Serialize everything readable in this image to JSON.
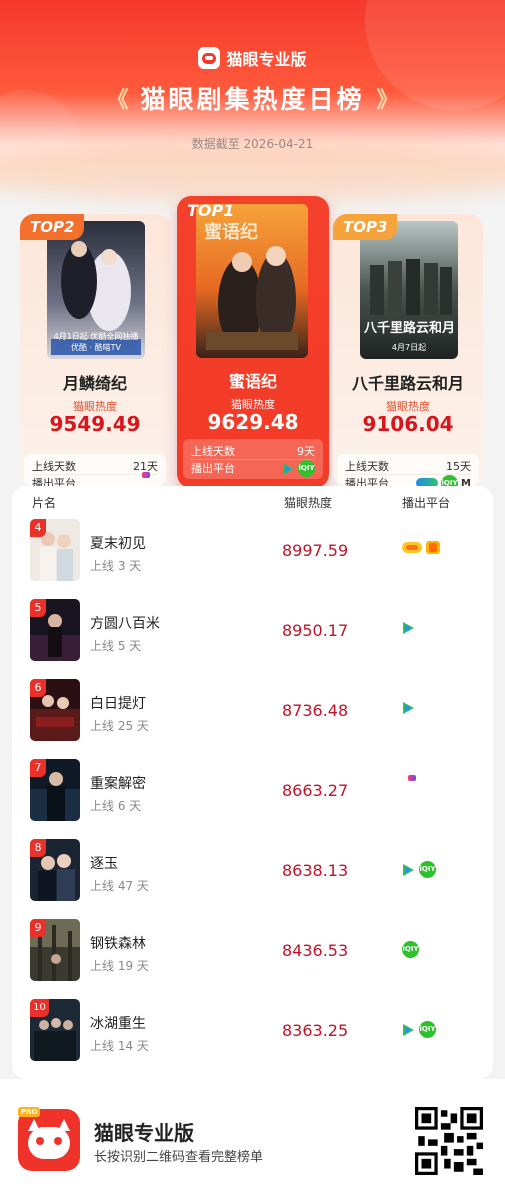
{
  "header": {
    "brand": "猫眼专业版",
    "title": "猫眼剧集热度日榜",
    "date_line": "数据截至 2026-04-21"
  },
  "top3": [
    {
      "rank_label": "TOP2",
      "name": "月鳞绮纪",
      "heat_label": "猫眼热度",
      "heat": "9549.49",
      "days_label": "上线天数",
      "days": "21天",
      "platform_label": "播出平台",
      "platforms": [
        "youku-icon"
      ],
      "poster_caption": "4月1日起 优酷全网独播",
      "poster_caption2": "优酷 · 酷喵TV"
    },
    {
      "rank_label": "TOP1",
      "name": "蜜语纪",
      "heat_label": "猫眼热度",
      "heat": "9629.48",
      "days_label": "上线天数",
      "days": "9天",
      "platform_label": "播出平台",
      "platforms": [
        "tencent-video-icon",
        "iqiyi-icon"
      ],
      "poster_art": "蜜语纪"
    },
    {
      "rank_label": "TOP3",
      "name": "八千里路云和月",
      "heat_label": "猫眼热度",
      "heat": "9106.04",
      "days_label": "上线天数",
      "days": "15天",
      "platform_label": "播出平台",
      "platforms": [
        "tencent-video-icon",
        "iqiyi-icon",
        "migu-icon"
      ],
      "poster_caption": "4月7日起",
      "poster_art": "八千里路云和月"
    }
  ],
  "list": {
    "headers": {
      "name": "片名",
      "heat": "猫眼热度",
      "platform": "播出平台"
    },
    "rows": [
      {
        "rank": "4",
        "name": "夏末初见",
        "days": "上线 3 天",
        "heat": "8997.59",
        "platforms": [
          "hunan-tv-icon",
          "mango-tv-icon"
        ]
      },
      {
        "rank": "5",
        "name": "方圆八百米",
        "days": "上线 5 天",
        "heat": "8950.17",
        "platforms": [
          "tencent-video-icon"
        ]
      },
      {
        "rank": "6",
        "name": "白日提灯",
        "days": "上线 25 天",
        "heat": "8736.48",
        "platforms": [
          "tencent-video-icon"
        ]
      },
      {
        "rank": "7",
        "name": "重案解密",
        "days": "上线 6 天",
        "heat": "8663.27",
        "platforms": [
          "youku-icon"
        ]
      },
      {
        "rank": "8",
        "name": "逐玉",
        "days": "上线 47 天",
        "heat": "8638.13",
        "platforms": [
          "tencent-video-icon",
          "iqiyi-icon"
        ]
      },
      {
        "rank": "9",
        "name": "钢铁森林",
        "days": "上线 19 天",
        "heat": "8436.53",
        "platforms": [
          "iqiyi-icon"
        ]
      },
      {
        "rank": "10",
        "name": "冰湖重生",
        "days": "上线 14 天",
        "heat": "8363.25",
        "platforms": [
          "tencent-video-icon",
          "iqiyi-icon"
        ]
      }
    ]
  },
  "footer": {
    "app_name": "猫眼专业版",
    "subtitle": "长按识别二维码查看完整榜单",
    "pro_badge": "PRO"
  },
  "colors": {
    "brand_red": "#f4382a",
    "heat_red": "#d8151c",
    "top2_tag": "#f36f2c",
    "top3_tag": "#f5a33a"
  }
}
